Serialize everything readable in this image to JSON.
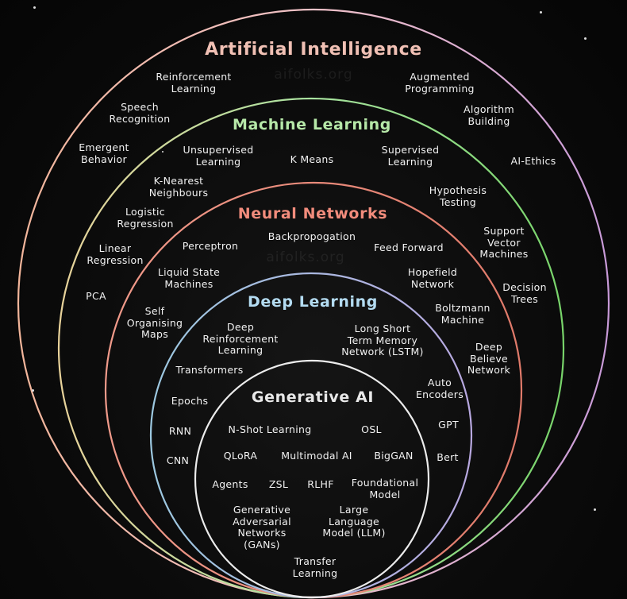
{
  "watermark": "aifolks.org",
  "layers": [
    {
      "title": "Artificial Intelligence",
      "color": "#f0b8b0",
      "items": [
        "Reinforcement\nLearning",
        "Augmented\nProgramming",
        "Speech\nRecognition",
        "Algorithm\nBuilding",
        "Emergent\nBehavior",
        "AI-Ethics"
      ]
    },
    {
      "title": "Machine Learning",
      "color": "#a9e3a0",
      "items": [
        "Unsupervised\nLearning",
        "K Means",
        "Supervised\nLearning",
        "K-Nearest\nNeighbours",
        "Hypothesis\nTesting",
        "Logistic\nRegression",
        "Support\nVector\nMachines",
        "Linear\nRegression",
        "PCA",
        "Decision\nTrees"
      ]
    },
    {
      "title": "Neural Networks",
      "color": "#f08a7a",
      "items": [
        "Backpropogation",
        "Perceptron",
        "Feed Forward",
        "Liquid State\nMachines",
        "Hopefield\nNetwork",
        "Self\nOrganising\nMaps",
        "Boltzmann\nMachine",
        "Deep\nBelieve\nNetwork"
      ]
    },
    {
      "title": "Deep Learning",
      "color": "#a9d4ec",
      "items": [
        "Deep\nReinforcement\nLearning",
        "Long Short\nTerm Memory\nNetwork (LSTM)",
        "Transformers",
        "Auto\nEncoders",
        "Epochs",
        "GPT",
        "RNN",
        "Bert",
        "CNN"
      ]
    },
    {
      "title": "Generative AI",
      "color": "#e8e8e8",
      "items": [
        "N-Shot Learning",
        "OSL",
        "QLoRA",
        "Multimodal AI",
        "BigGAN",
        "Agents",
        "ZSL",
        "RLHF",
        "Foundational\nModel",
        "Generative\nAdversarial\nNetworks\n(GANs)",
        "Large\nLanguage\nModel (LLM)",
        "Transfer\nLearning"
      ]
    }
  ]
}
